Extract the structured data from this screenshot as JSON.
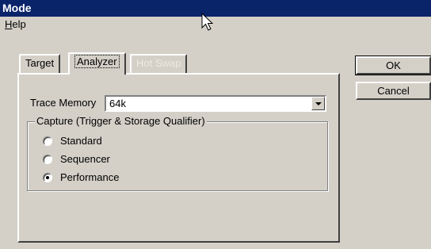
{
  "window": {
    "title": "Mode"
  },
  "menu": {
    "help_first": "H",
    "help_rest": "elp"
  },
  "tabs": [
    {
      "label": "Target"
    },
    {
      "label": "Analyzer"
    },
    {
      "label": "Hot Swap"
    }
  ],
  "trace": {
    "label": "Trace Memory",
    "value": "64k"
  },
  "capture": {
    "legend": "Capture (Trigger & Storage Qualifier)",
    "options": [
      {
        "label": "Standard"
      },
      {
        "label": "Sequencer"
      },
      {
        "label": "Performance"
      }
    ],
    "selected": "Performance"
  },
  "buttons": {
    "ok": "OK",
    "cancel": "Cancel"
  }
}
